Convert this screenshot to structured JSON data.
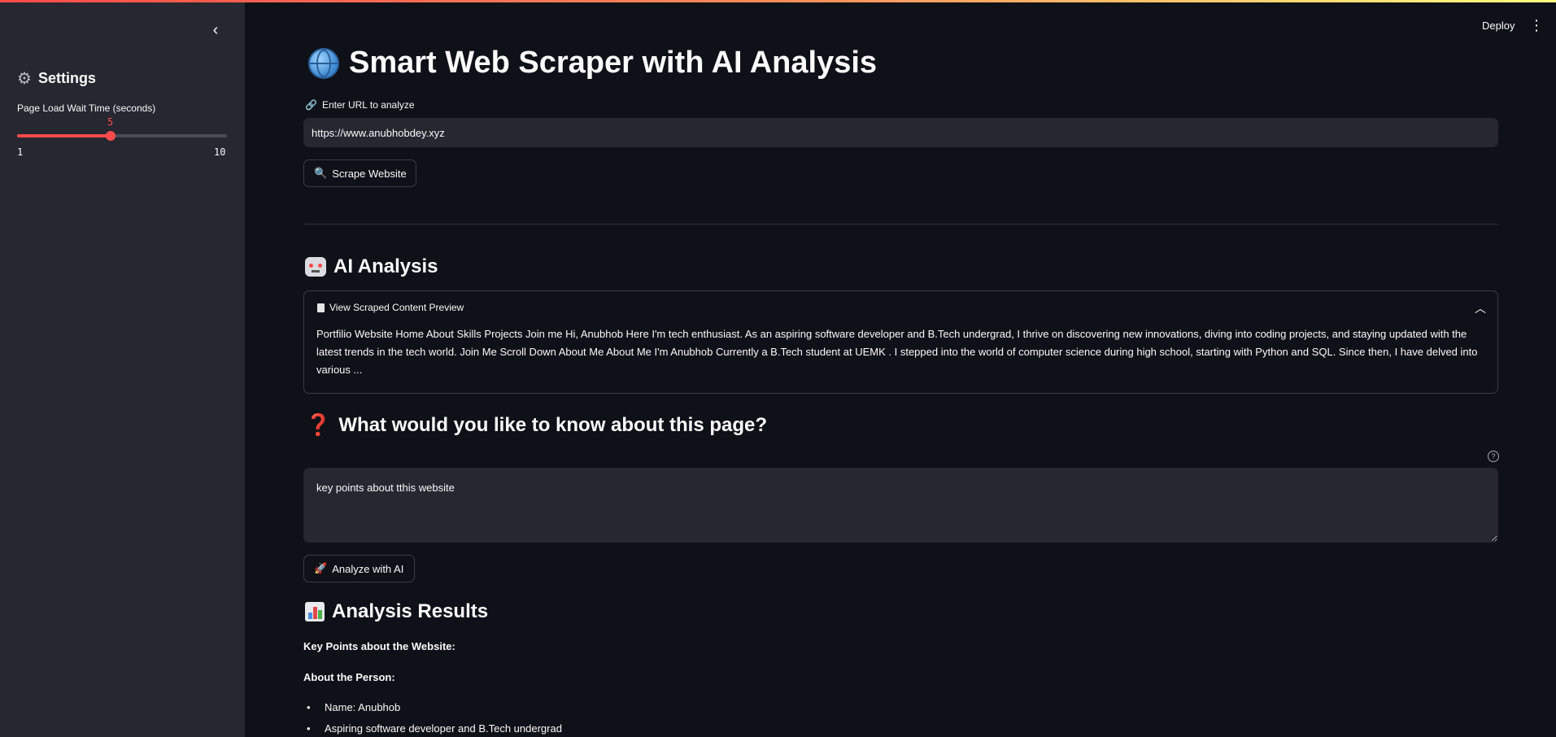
{
  "header": {
    "deploy_label": "Deploy",
    "menu_icon": "⋮"
  },
  "sidebar": {
    "collapse_icon": "‹",
    "settings_title": "Settings",
    "slider": {
      "label": "Page Load Wait Time (seconds)",
      "value": "5",
      "min": "1",
      "max": "10",
      "accent": "#ff4b4b"
    }
  },
  "main": {
    "title": "Smart Web Scraper with AI Analysis",
    "url_label": "Enter URL to analyze",
    "url_value": "https://www.anubhobdey.xyz",
    "scrape_button": "Scrape Website",
    "ai_title": "AI Analysis",
    "expander": {
      "title": "View Scraped Content Preview",
      "content": "Portfilio Website Home About Skills Projects Join me Hi, Anubhob Here I'm tech enthusiast. As an aspiring software developer and B.Tech undergrad, I thrive on discovering new innovations, diving into coding projects, and staying updated with the latest trends in the tech world. Join Me Scroll Down About Me About Me I'm Anubhob Currently a B.Tech student at UEMK . I stepped into the world of computer science during high school, starting with Python and SQL. Since then, I have delved into various ..."
    },
    "question_title": "What would you like to know about this page?",
    "question_value": "key points about tthis website",
    "analyze_button": "Analyze with AI",
    "results": {
      "title": "Analysis Results",
      "heading": "Key Points about the Website:",
      "subheading": "About the Person:",
      "bullets": [
        "Name: Anubhob",
        "Aspiring software developer and B.Tech undergrad"
      ]
    }
  }
}
